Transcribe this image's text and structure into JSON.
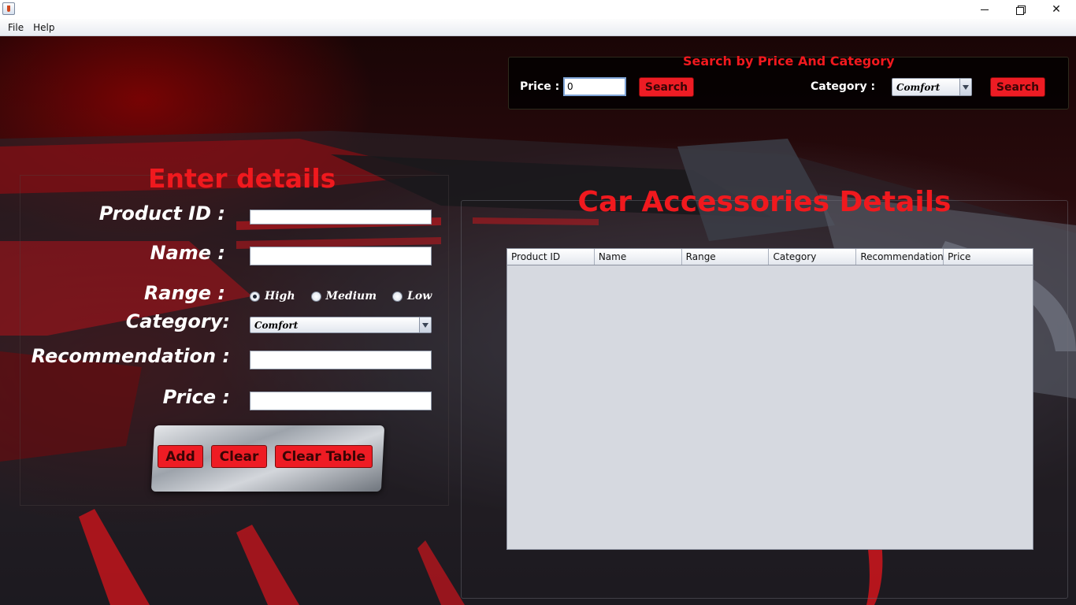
{
  "window": {
    "minimize_label": "—",
    "close_label": "✕"
  },
  "menu": [
    "File",
    "Help"
  ],
  "search": {
    "title": "Search by Price And Category",
    "price_label": "Price :",
    "price_value": "0",
    "search_label_1": "Search",
    "category_label": "Category :",
    "category_value": "Comfort",
    "search_label_2": "Search"
  },
  "form": {
    "heading": "Enter details",
    "product_id_label": "Product ID :",
    "name_label": "Name :",
    "range_label": "Range :",
    "range_options": [
      "High",
      "Medium",
      "Low"
    ],
    "range_selected": "High",
    "category_label": "Category:",
    "category_value": "Comfort",
    "recommendation_label": "Recommendation :",
    "price_label": "Price :",
    "add_label": "Add",
    "clear_label": "Clear",
    "clear_table_label": "Clear Table"
  },
  "table": {
    "heading": "Car Accessories Details",
    "columns": [
      "Product ID",
      "Name",
      "Range",
      "Category",
      "Recommendation",
      "Price"
    ],
    "rows": []
  },
  "colors": {
    "accent_red": "#ee1c24",
    "heading_red": "#f0191e",
    "table_bg": "#d6d9e0"
  }
}
